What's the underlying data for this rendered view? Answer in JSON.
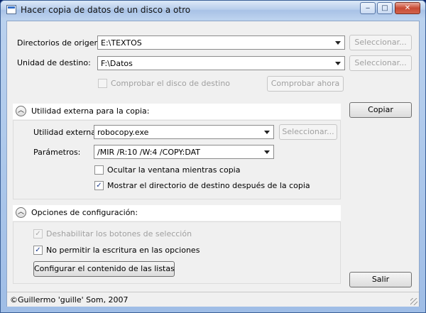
{
  "window": {
    "title": "Hacer copia de datos de un disco a otro",
    "controls": {
      "minimize": "‒",
      "maximize": "□",
      "close": "✕"
    }
  },
  "origin": {
    "label": "Directorios de origen:",
    "value": "E:\\TEXTOS",
    "select_button": "Seleccionar..."
  },
  "destination": {
    "label": "Unidad de destino:",
    "value": "F:\\Datos",
    "select_button": "Seleccionar...",
    "check_disk_label": "Comprobar el disco de destino",
    "check_now_button": "Comprobar ahora"
  },
  "copy_button": "Copiar",
  "exit_button": "Salir",
  "external_section": {
    "title": "Utilidad externa para la copia:",
    "utility_label": "Utilidad externa:",
    "utility_value": "robocopy.exe",
    "select_button": "Seleccionar...",
    "params_label": "Parámetros:",
    "params_value": "/MIR /R:10 /W:4 /COPY:DAT",
    "hide_window_label": "Ocultar la ventana mientras copia",
    "hide_window_checked": false,
    "show_dest_label": "Mostrar el directorio de destino después de la copia",
    "show_dest_checked": true
  },
  "config_section": {
    "title": "Opciones de configuración:",
    "disable_buttons_label": "Deshabilitar los botones de selección",
    "disable_buttons_checked": true,
    "no_write_label": "No permitir la escritura en las opciones",
    "no_write_checked": true,
    "configure_lists_button": "Configurar el contenido de las listas"
  },
  "status": {
    "text": "©Guillermo 'guille' Som, 2007"
  },
  "icons": {
    "checkmark": "✓",
    "collapse": "︿"
  }
}
